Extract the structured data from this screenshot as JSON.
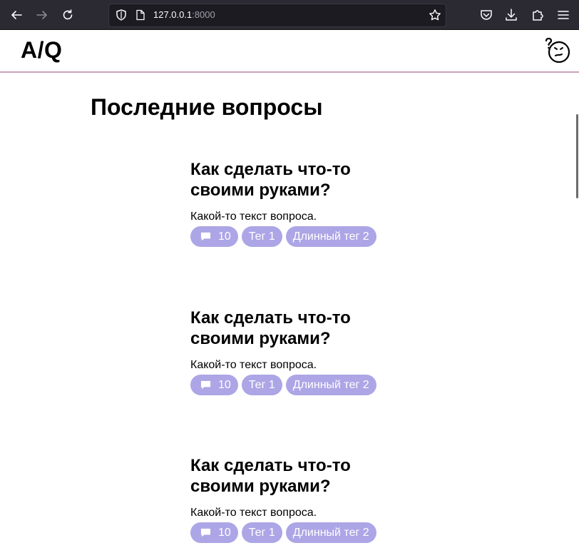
{
  "browser": {
    "url_host": "127.0.0.1",
    "url_port": ":8000"
  },
  "header": {
    "logo": "A/Q"
  },
  "main": {
    "title": "Последние вопросы",
    "questions": [
      {
        "title": "Как сделать что-то своими руками?",
        "text": "Какой-то текст вопроса.",
        "answers": "10",
        "tags": [
          "Тег 1",
          "Длинный тег 2"
        ]
      },
      {
        "title": "Как сделать что-то своими руками?",
        "text": "Какой-то текст вопроса.",
        "answers": "10",
        "tags": [
          "Тег 1",
          "Длинный тег 2"
        ]
      },
      {
        "title": "Как сделать что-то своими руками?",
        "text": "Какой-то текст вопроса.",
        "answers": "10",
        "tags": [
          "Тег 1",
          "Длинный тег 2"
        ]
      }
    ]
  },
  "icons": {
    "back": "back-arrow-icon",
    "forward": "forward-arrow-icon",
    "reload": "reload-icon",
    "shield": "shield-icon",
    "page": "page-icon",
    "bookmark": "star-icon",
    "pocket": "pocket-icon",
    "download": "download-icon",
    "extensions": "puzzle-icon",
    "menu": "hamburger-icon",
    "comment": "comment-icon",
    "avatar": "confused-face-icon"
  },
  "colors": {
    "chip_bg": "#aca6e6",
    "header_border": "#c9a3b8",
    "browser_bg": "#2b2a33"
  }
}
